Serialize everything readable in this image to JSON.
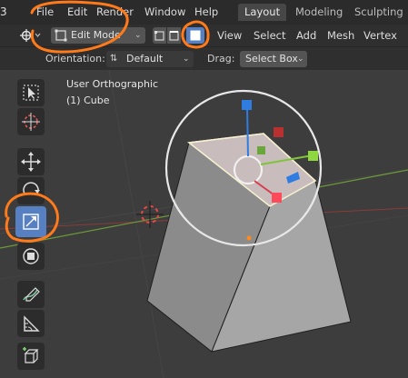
{
  "menubar": {
    "items": [
      "File",
      "Edit",
      "Render",
      "Window",
      "Help"
    ],
    "workspaces": [
      "Layout",
      "Modeling",
      "Sculpting"
    ],
    "active_workspace": "Layout"
  },
  "header": {
    "mode": "Edit Mode",
    "menus": [
      "View",
      "Select",
      "Add",
      "Mesh",
      "Vertex"
    ],
    "select_mode_active": "face"
  },
  "tool_settings": {
    "orientation_label": "Orientation:",
    "orientation_value": "Default",
    "drag_label": "Drag:",
    "drag_value": "Select Box"
  },
  "viewport": {
    "view_name": "User Orthographic",
    "object_name": "(1) Cube"
  },
  "toolbar": {
    "tools": [
      "select-box",
      "cursor",
      "move",
      "rotate",
      "scale",
      "transform",
      "annotate",
      "measure",
      "add-cube"
    ],
    "active_tool": "scale"
  },
  "colors": {
    "accent": "#5680c2",
    "annotation": "#ff7a1a",
    "axis_x": "#d83b4c",
    "axis_y": "#7fc43b",
    "axis_z": "#2f7de1"
  }
}
